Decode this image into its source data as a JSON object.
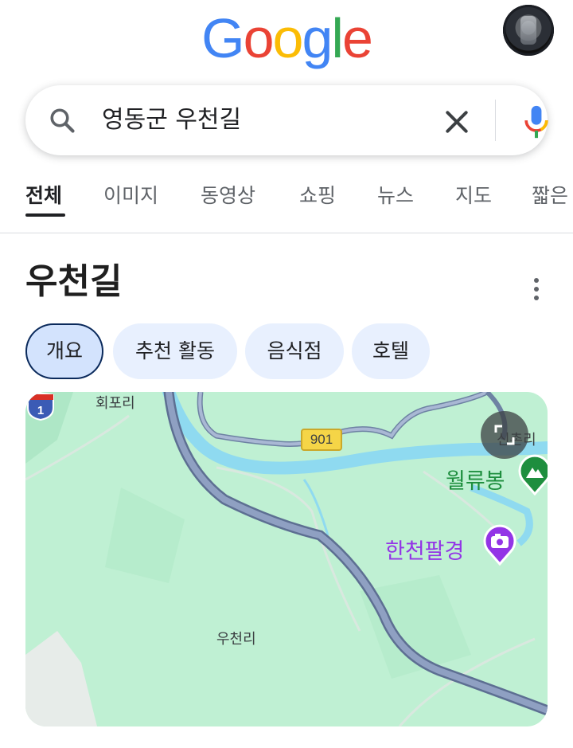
{
  "header": {
    "logo_letters": [
      "G",
      "o",
      "o",
      "g",
      "l",
      "e"
    ],
    "logo_colors": [
      "#4285F4",
      "#EA4335",
      "#FBBC05",
      "#4285F4",
      "#34A853",
      "#EA4335"
    ]
  },
  "search": {
    "query": "영동군 우천길",
    "icons": [
      "search-icon",
      "close-icon",
      "microphone-icon"
    ]
  },
  "tabs": [
    "전체",
    "이미지",
    "동영상",
    "쇼핑",
    "뉴스",
    "지도",
    "짧은"
  ],
  "result": {
    "title": "우천길",
    "chips": [
      "개요",
      "추천 활동",
      "음식점",
      "호텔"
    ]
  },
  "map": {
    "labels": {
      "village1": "회포리",
      "village2": "우천리",
      "village3": "신촌리"
    },
    "road_shields": {
      "route_901": "901",
      "route_1": "1"
    },
    "pois": [
      {
        "name": "월류봉",
        "icon": "mountain-icon",
        "color": "#1e8e3e"
      },
      {
        "name": "한천팔경",
        "icon": "camera-icon",
        "color": "#9334e6"
      }
    ]
  }
}
